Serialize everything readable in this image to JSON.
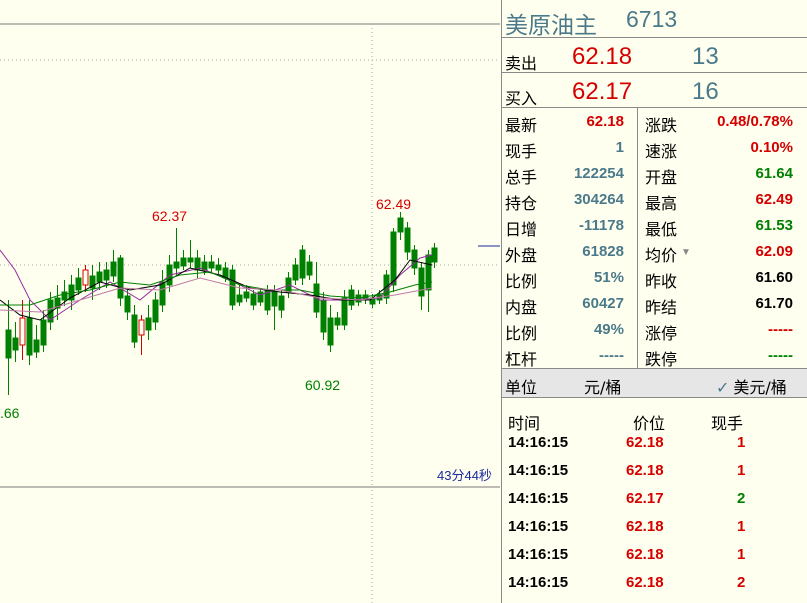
{
  "chart": {
    "countdown": "43分44秒",
    "high_label": "62.49",
    "high_label_2": "62.37",
    "low_label": "60.92",
    "left_low_label": ".66"
  },
  "header": {
    "name": "美原油主",
    "code": "6713"
  },
  "sell": {
    "label": "卖出",
    "price": "62.18",
    "volume": "13"
  },
  "buy": {
    "label": "买入",
    "price": "62.17",
    "volume": "16"
  },
  "stats_left": [
    {
      "label": "最新",
      "value": "62.18",
      "color": "red"
    },
    {
      "label": "现手",
      "value": "1",
      "color": "teal"
    },
    {
      "label": "总手",
      "value": "122254",
      "color": "teal"
    },
    {
      "label": "持仓",
      "value": "304264",
      "color": "teal"
    },
    {
      "label": "日增",
      "value": "-11178",
      "color": "teal"
    },
    {
      "label": "外盘",
      "value": "61828",
      "color": "teal"
    },
    {
      "label": "比例",
      "value": "51%",
      "color": "teal"
    },
    {
      "label": "内盘",
      "value": "60427",
      "color": "teal"
    },
    {
      "label": "比例",
      "value": "49%",
      "color": "teal"
    },
    {
      "label": "杠杆",
      "value": "-----",
      "color": "teal"
    }
  ],
  "stats_right": [
    {
      "label": "涨跌",
      "value": "0.48/0.78%",
      "color": "red"
    },
    {
      "label": "速涨",
      "value": "0.10%",
      "color": "red"
    },
    {
      "label": "开盘",
      "value": "61.64",
      "color": "green"
    },
    {
      "label": "最高",
      "value": "62.49",
      "color": "red"
    },
    {
      "label": "最低",
      "value": "61.53",
      "color": "green"
    },
    {
      "label": "均价",
      "value": "62.09",
      "color": "red"
    },
    {
      "label": "昨收",
      "value": "61.60",
      "color": "black"
    },
    {
      "label": "昨结",
      "value": "61.70",
      "color": "black"
    },
    {
      "label": "涨停",
      "value": "-----",
      "color": "red"
    },
    {
      "label": "跌停",
      "value": "-----",
      "color": "green"
    }
  ],
  "unit_bar": {
    "label": "单位",
    "unit": "元/桶",
    "alt_unit": "美元/桶"
  },
  "trades": {
    "headers": {
      "time": "时间",
      "price": "价位",
      "qty": "现手"
    },
    "rows": [
      {
        "time": "14:16:15",
        "price": "62.18",
        "qty": "1",
        "price_color": "red",
        "qty_color": "red"
      },
      {
        "time": "14:16:15",
        "price": "62.18",
        "qty": "1",
        "price_color": "red",
        "qty_color": "red"
      },
      {
        "time": "14:16:15",
        "price": "62.17",
        "qty": "2",
        "price_color": "red",
        "qty_color": "green"
      },
      {
        "time": "14:16:15",
        "price": "62.18",
        "qty": "1",
        "price_color": "red",
        "qty_color": "red"
      },
      {
        "time": "14:16:15",
        "price": "62.18",
        "qty": "1",
        "price_color": "red",
        "qty_color": "red"
      },
      {
        "time": "14:16:15",
        "price": "62.18",
        "qty": "2",
        "price_color": "red",
        "qty_color": "red"
      }
    ]
  },
  "colors": {
    "up": "#d40000",
    "down": "#008000",
    "teal": "#4a7a8a",
    "bg": "#fffff0"
  }
}
